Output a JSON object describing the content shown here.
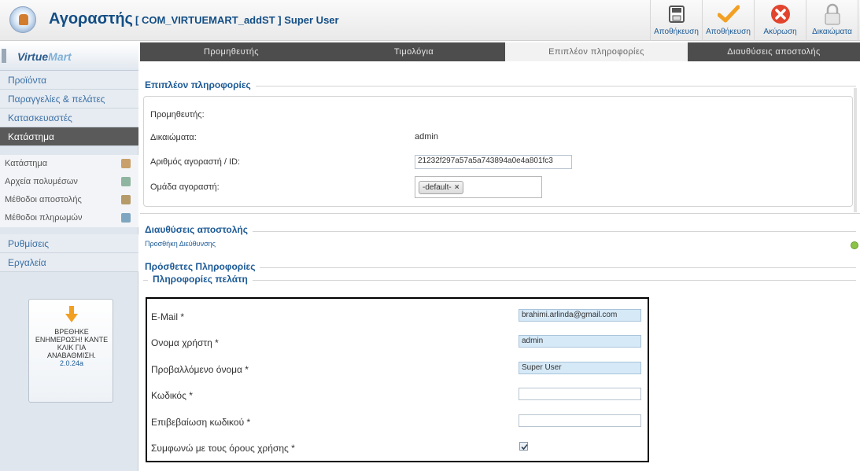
{
  "header": {
    "title": "Αγοραστής",
    "subtitle": "[ COM_VIRTUEMART_addST ] Super User",
    "toolbar": [
      {
        "label": "Αποθήκευση",
        "icon": "floppy-icon"
      },
      {
        "label": "Αποθήκευση",
        "icon": "checkmark-icon"
      },
      {
        "label": "Ακύρωση",
        "icon": "cancel-icon"
      },
      {
        "label": "Δικαιώματα",
        "icon": "lock-icon"
      }
    ]
  },
  "tabs": [
    {
      "label": "Προμηθευτής"
    },
    {
      "label": "Τιμολόγια"
    },
    {
      "label": "Επιπλέον πληροφορίες"
    },
    {
      "label": "Διαυθύσεις αποστολής"
    }
  ],
  "sidebar": {
    "brand": {
      "part1": "Virtue",
      "part2": "Mart"
    },
    "menu": [
      {
        "label": "Προϊόντα"
      },
      {
        "label": "Παραγγελίες & πελάτες"
      },
      {
        "label": "Κατασκευαστές"
      },
      {
        "label": "Κατάστημα"
      }
    ],
    "sub": [
      {
        "label": "Κατάστημα",
        "icon": "store-icon"
      },
      {
        "label": "Αρχεία πολυμέσων",
        "icon": "media-icon"
      },
      {
        "label": "Μέθοδοι αποστολής",
        "icon": "truck-icon"
      },
      {
        "label": "Μέθοδοι πληρωμών",
        "icon": "payment-icon"
      }
    ],
    "menu2": [
      {
        "label": "Ρυθμίσεις"
      },
      {
        "label": "Εργαλεία"
      }
    ],
    "update": {
      "line1": "ΒΡΕΘΗΚΕ",
      "line2": "ΕΝΗΜΕΡΩΣΗ! ΚΑΝΤΕ",
      "line3": "ΚΛΙΚ ΓΙΑ",
      "line4": "ΑΝΑΒΑΘΜΙΣΗ.",
      "version": "2.0.24a"
    }
  },
  "extra_info": {
    "legend": "Επιπλέον πληροφορίες",
    "vendor_label": "Προμηθευτής:",
    "permissions_label": "Δικαιώματα:",
    "permissions_value": "admin",
    "customer_id_label": "Αριθμός αγοραστή / ID:",
    "customer_id_value": "21232f297a57a5a743894a0e4a801fc3",
    "group_label": "Ομάδα αγοραστή:",
    "group_value": "-default-",
    "group_remove": "×"
  },
  "shipping": {
    "legend": "Διαυθύσεις αποστολής",
    "add_link": "Προσθήκη Διεύθυνσης"
  },
  "additional": {
    "legend": "Πρόσθετες Πληροφορίες",
    "customer_legend": "Πληροφορίες πελάτη",
    "fields": [
      {
        "label": "E-Mail *",
        "value": "brahimi.arlinda@gmail.com"
      },
      {
        "label": "Ονομα χρήστη *",
        "value": "admin"
      },
      {
        "label": "Προβαλλόμενο όνομα *",
        "value": "Super User"
      },
      {
        "label": "Κωδικός *",
        "value": ""
      },
      {
        "label": "Επιβεβαίωση κωδικού *",
        "value": ""
      },
      {
        "label": "Συμφωνώ με τους όρους χρήσης *",
        "checked": true
      }
    ]
  },
  "colors": {
    "accent": "#1c5a96",
    "tabbar": "#4d4d4d",
    "sidebar_active": "#5a5a5a",
    "field_fill": "#d6e9f7"
  }
}
